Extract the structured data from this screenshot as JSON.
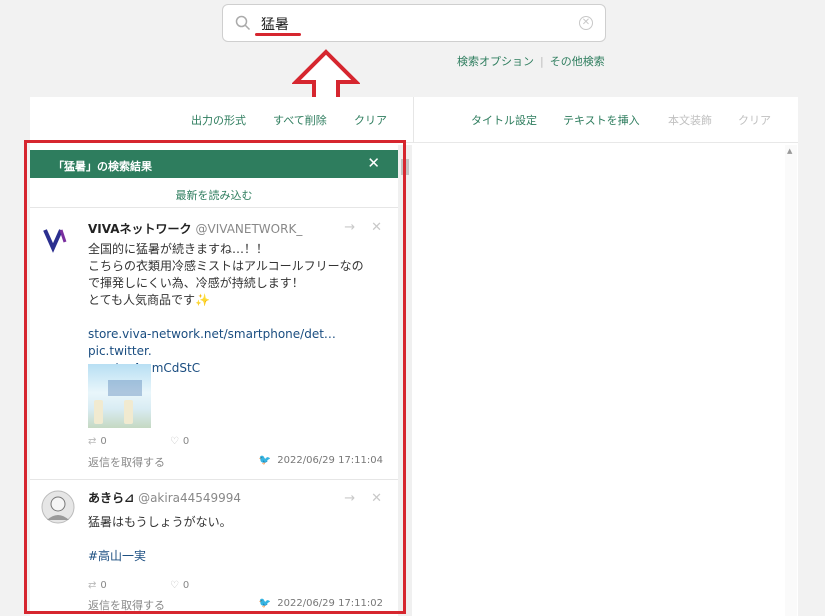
{
  "search": {
    "query": "猛暑",
    "options_link": "検索オプション",
    "other_link": "その他検索"
  },
  "toolbar": {
    "left": [
      "出力の形式",
      "すべて削除",
      "クリア"
    ],
    "right": [
      "タイトル設定",
      "テキストを挿入",
      "本文装飾",
      "クリア"
    ]
  },
  "results": {
    "title": "「猛暑」の検索結果",
    "reload": "最新を読み込む",
    "tweets": [
      {
        "name": "VIVAネットワーク",
        "handle": "@VIVANETWORK_",
        "lines": [
          "全国的に猛暑が続きますね…！！",
          "こちらの衣類用冷感ミストはアルコールフリーなの",
          "で揮発しにくい為、冷感が持続します！",
          "とても人気商品です✨"
        ],
        "link": "store.viva-network.net/smartphone/det…",
        "pic": "pic.twitter.",
        "pic2": "com/px4mmCdStC",
        "retweets": "0",
        "likes": "0",
        "reply": "返信を取得する",
        "time": "2022/06/29 17:11:04"
      },
      {
        "name": "あきら⊿",
        "handle": "@akira44549994",
        "text": "猛暑はもうしょうがない。",
        "hashtag": "#高山一実",
        "retweets": "0",
        "likes": "0",
        "reply": "返信を取得する",
        "time": "2022/06/29 17:11:02"
      }
    ]
  },
  "colors": {
    "accent": "#2e7d5e",
    "highlight": "#d6262f"
  }
}
